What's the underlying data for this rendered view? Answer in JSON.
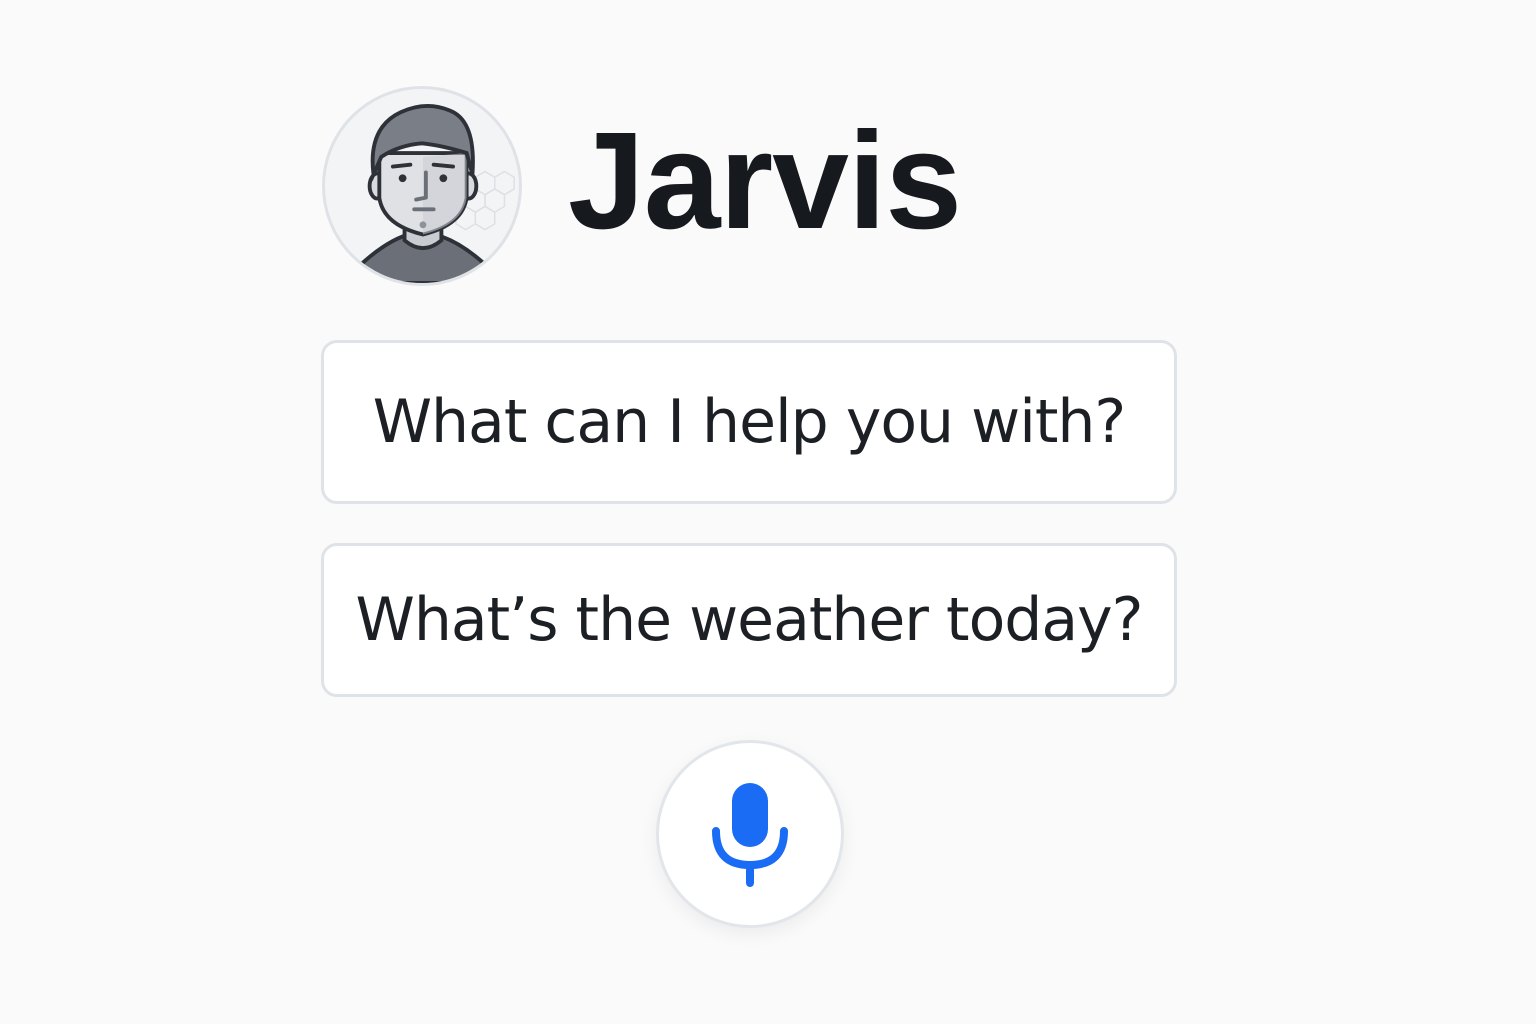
{
  "assistant": {
    "name": "Jarvis",
    "avatar_icon": "person-avatar-icon"
  },
  "suggestions": [
    {
      "label": "What can I help you with?"
    },
    {
      "label": "What’s the weather today?"
    }
  ],
  "mic": {
    "icon": "microphone-icon",
    "color": "#1a6cf5"
  },
  "colors": {
    "background": "#fafafa",
    "text": "#16191d",
    "border": "#dfe3e8",
    "accent": "#1a6cf5"
  }
}
